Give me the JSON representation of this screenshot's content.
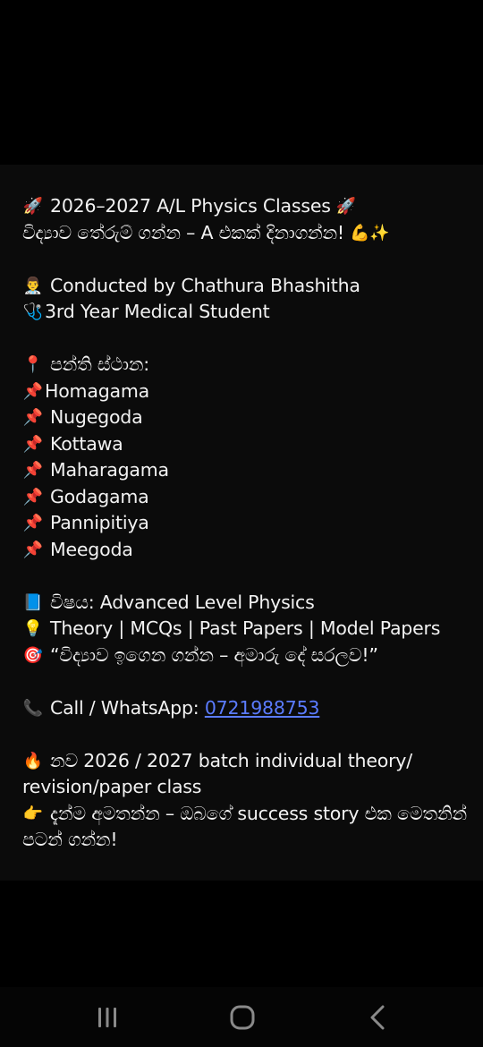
{
  "message": {
    "lines": [
      {
        "icon": "🚀",
        "icon_name": "rocket-icon",
        "text": "2026–2027 A/L Physics Classes",
        "trailing_icon": "🚀",
        "trailing_icon_name": "rocket-icon"
      },
      {
        "text": "විද්‍යාව තේරුම් ගන්න – A එකක් දිනාගන්න!",
        "trailing_icon": "💪✨",
        "trailing_icon_name": "flexed-biceps-sparkles-icon"
      },
      {
        "blank": true
      },
      {
        "icon": "👨‍⚕️",
        "icon_name": "doctor-icon",
        "text": "Conducted by Chathura Bhashitha"
      },
      {
        "icon": "🩺",
        "icon_name": "stethoscope-icon",
        "text": "3rd Year Medical Student",
        "tight": true
      },
      {
        "blank": true
      },
      {
        "icon": "📍",
        "icon_name": "location-pin-icon",
        "text": "පන්ති ස්ථාන:"
      },
      {
        "icon": "📌",
        "icon_name": "pushpin-icon",
        "text": "Homagama",
        "tight": true
      },
      {
        "icon": "📌",
        "icon_name": "pushpin-icon",
        "text": "Nugegoda"
      },
      {
        "icon": "📌",
        "icon_name": "pushpin-icon",
        "text": "Kottawa"
      },
      {
        "icon": "📌",
        "icon_name": "pushpin-icon",
        "text": "Maharagama"
      },
      {
        "icon": "📌",
        "icon_name": "pushpin-icon",
        "text": "Godagama"
      },
      {
        "icon": "📌",
        "icon_name": "pushpin-icon",
        "text": "Pannipitiya"
      },
      {
        "icon": "📌",
        "icon_name": "pushpin-icon",
        "text": "Meegoda"
      },
      {
        "blank": true
      },
      {
        "icon": "📘",
        "icon_name": "blue-book-icon",
        "text": "විෂය: Advanced Level Physics"
      },
      {
        "icon": "💡",
        "icon_name": "light-bulb-icon",
        "text": "Theory | MCQs | Past Papers | Model Papers"
      },
      {
        "icon": "🎯",
        "icon_name": "target-icon",
        "text": "“විද්‍යාව ඉගෙන ගන්න – අමාරු දේ සරලව!”"
      },
      {
        "blank": true
      },
      {
        "icon": "📞",
        "icon_name": "telephone-icon",
        "text": "Call / WhatsApp: ",
        "link": "0721988753"
      },
      {
        "blank": true
      },
      {
        "icon": "🔥",
        "icon_name": "fire-icon",
        "text": "නව 2026 / 2027 batch individual theory/ revision/paper class",
        "wrap": true
      },
      {
        "icon": "👉",
        "icon_name": "pointing-right-icon",
        "text": "දැන්ම අමතන්න – ඔබගේ success story එක මෙතනින් පටන් ගන්න!",
        "wrap": true
      }
    ]
  },
  "nav": {
    "recent_apps": "recent-apps-icon",
    "home": "home-icon",
    "back": "back-icon"
  },
  "colors": {
    "background": "#000000",
    "card": "#0b0b0b",
    "text": "#f2f2f2",
    "link": "#5b7cff",
    "nav_icon": "#8a8a8a"
  }
}
